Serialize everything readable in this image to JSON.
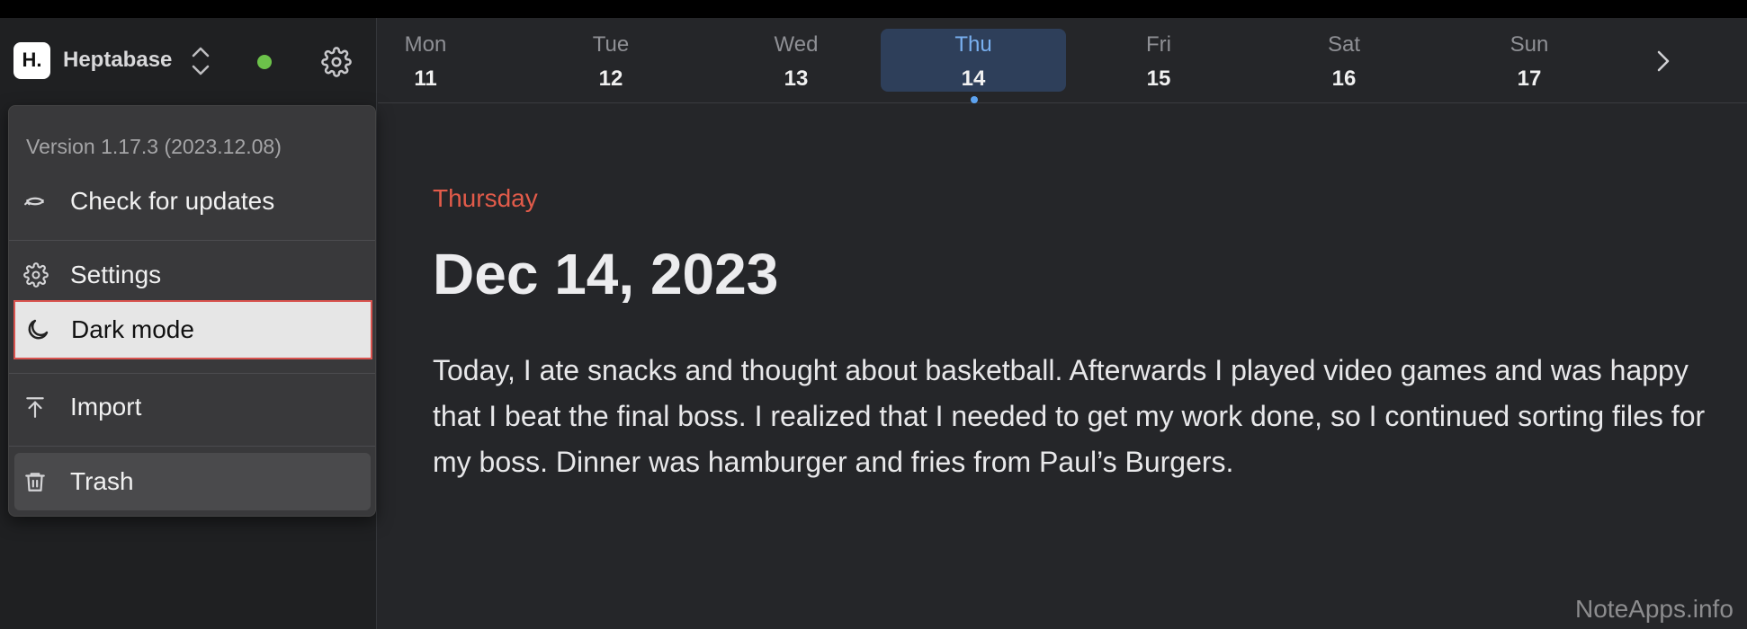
{
  "workspace": {
    "logo_text": "H.",
    "name": "Heptabase"
  },
  "menu": {
    "version": "Version 1.17.3 (2023.12.08)",
    "check_updates": "Check for updates",
    "settings": "Settings",
    "dark_mode": "Dark mode",
    "import": "Import",
    "trash": "Trash"
  },
  "week": {
    "days": [
      {
        "name": "Mon",
        "num": "11"
      },
      {
        "name": "Tue",
        "num": "12"
      },
      {
        "name": "Wed",
        "num": "13"
      },
      {
        "name": "Thu",
        "num": "14"
      },
      {
        "name": "Fri",
        "num": "15"
      },
      {
        "name": "Sat",
        "num": "16"
      },
      {
        "name": "Sun",
        "num": "17"
      }
    ],
    "active_index": 3
  },
  "journal": {
    "weekday": "Thursday",
    "date": "Dec 14, 2023",
    "body": "Today, I ate snacks and thought about basketball. Afterwards I played video games and was happy that I beat the final boss. I realized that I needed to get my work done, so I continued sorting files for my boss. Dinner was hamburger and fries from Paul’s Burgers."
  },
  "watermark": "NoteApps.info",
  "colors": {
    "accent": "#79b0f0",
    "weekday": "#e25b4a",
    "status": "#6cc24a",
    "highlight_border": "#d9534f"
  }
}
